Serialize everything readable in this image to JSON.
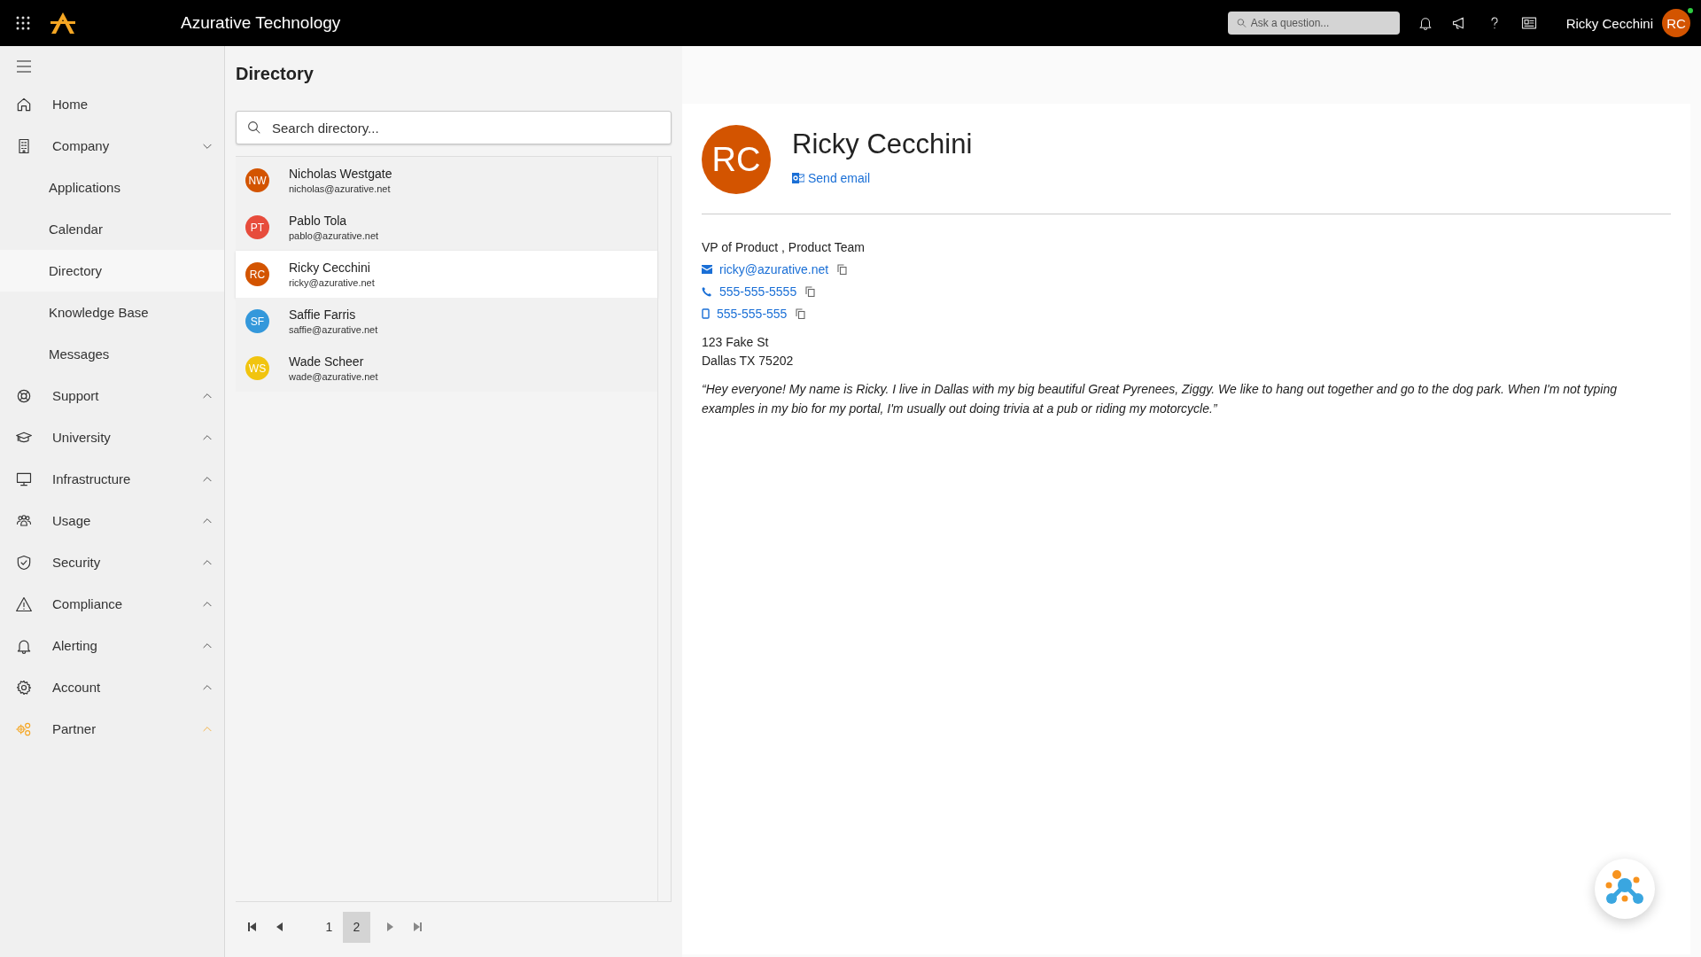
{
  "topbar": {
    "brand": "Azurative Technology",
    "search": {
      "placeholder": "Ask a question..."
    },
    "user": {
      "name": "Ricky Cecchini",
      "initials": "RC",
      "online": true
    }
  },
  "sidebar": {
    "items": [
      {
        "label": "Home",
        "accent": false
      },
      {
        "label": "Company",
        "expanded": true,
        "accent": false,
        "children": [
          {
            "label": "Applications",
            "selected": false
          },
          {
            "label": "Calendar",
            "selected": false
          },
          {
            "label": "Directory",
            "selected": true
          },
          {
            "label": "Knowledge Base",
            "selected": false
          },
          {
            "label": "Messages",
            "selected": false
          }
        ]
      },
      {
        "label": "Support",
        "expanded": false,
        "accent": false
      },
      {
        "label": "University",
        "expanded": false,
        "accent": false
      },
      {
        "label": "Infrastructure",
        "expanded": false,
        "accent": false
      },
      {
        "label": "Usage",
        "expanded": false,
        "accent": false
      },
      {
        "label": "Security",
        "expanded": false,
        "accent": false
      },
      {
        "label": "Compliance",
        "expanded": false,
        "accent": false
      },
      {
        "label": "Alerting",
        "expanded": false,
        "accent": false
      },
      {
        "label": "Account",
        "expanded": false,
        "accent": false
      },
      {
        "label": "Partner",
        "expanded": false,
        "accent": true
      }
    ]
  },
  "directory": {
    "title": "Directory",
    "search": {
      "placeholder": "Search directory..."
    },
    "people": [
      {
        "initials": "NW",
        "name": "Nicholas Westgate",
        "email": "nicholas@azurative.net",
        "color": "#d35400",
        "selected": false
      },
      {
        "initials": "PT",
        "name": "Pablo Tola",
        "email": "pablo@azurative.net",
        "color": "#e74c3c",
        "selected": false
      },
      {
        "initials": "RC",
        "name": "Ricky Cecchini",
        "email": "ricky@azurative.net",
        "color": "#d35400",
        "selected": true
      },
      {
        "initials": "SF",
        "name": "Saffie Farris",
        "email": "saffie@azurative.net",
        "color": "#3498db",
        "selected": false
      },
      {
        "initials": "WS",
        "name": "Wade Scheer",
        "email": "wade@azurative.net",
        "color": "#f1c40f",
        "selected": false
      }
    ],
    "pages": [
      {
        "label": "1",
        "selected": false
      },
      {
        "label": "2",
        "selected": true
      }
    ]
  },
  "profile": {
    "initials": "RC",
    "name": "Ricky Cecchini",
    "send_email": "Send email",
    "title": "VP of Product , Product Team",
    "contacts": [
      {
        "kind": "email",
        "value": "ricky@azurative.net"
      },
      {
        "kind": "phone",
        "value": "555-555-5555"
      },
      {
        "kind": "mobile",
        "value": "555-555-555"
      }
    ],
    "address": [
      "123 Fake St",
      "Dallas TX 75202"
    ],
    "bio": "“Hey everyone! My name is Ricky. I live in Dallas with my big beautiful Great Pyrenees, Ziggy. We like to hang out together and go to the dog park. When I'm not typing examples in my bio for my portal, I'm usually out doing trivia at a pub or riding my motorcycle.”"
  }
}
